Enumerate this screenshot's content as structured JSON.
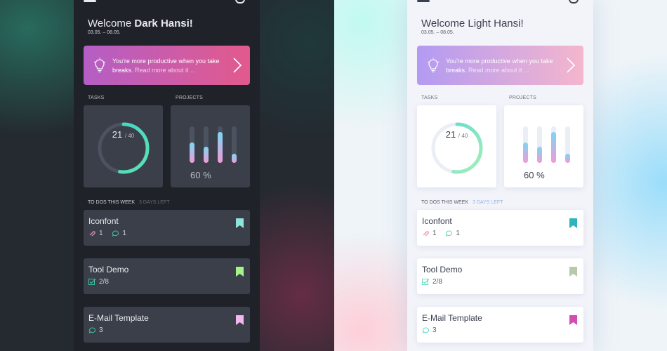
{
  "dark": {
    "welcome_prefix": "Welcome",
    "welcome_name": "Dark Hansi!",
    "dates": "03.05.  –  08.05.",
    "banner": {
      "text": "You're more productive when you take breaks.",
      "more": " Read more about it ..."
    },
    "tasks_label": "TASKS",
    "projects_label": "PROJECTS",
    "tasks_done": "21",
    "tasks_total": "/ 40",
    "tasks_progress": 0.525,
    "projects_percent": "60 %",
    "project_bars": [
      0.55,
      0.45,
      0.85,
      0.25
    ],
    "todo_label": "TO DOS THIS WEEK",
    "todo_sub": "3 DAYS LEFT",
    "todos": [
      {
        "title": "Iconfont",
        "attachments": "1",
        "comments": "1",
        "bookmark_color": "#8fe3dc"
      },
      {
        "title": "Tool Demo",
        "checks": "2/8",
        "bookmark_color": "#a6f28a"
      },
      {
        "title": "E-Mail Template",
        "comments": "3",
        "bookmark_color": "#f0b8ef"
      }
    ]
  },
  "light": {
    "welcome_prefix": "Welcome",
    "welcome_name": "Light Hansi!",
    "dates": "03.05.  –  08.05.",
    "banner": {
      "text": "You're more productive when you take breaks.",
      "more": " Read more about it ..."
    },
    "tasks_label": "TASKS",
    "projects_label": "PROJECTS",
    "tasks_done": "21",
    "tasks_total": "/ 40",
    "tasks_progress": 0.525,
    "projects_percent": "60 %",
    "project_bars": [
      0.55,
      0.45,
      0.85,
      0.25
    ],
    "todo_label": "TO DOS THIS WEEK",
    "todo_sub": "3 DAYS LEFT",
    "todos": [
      {
        "title": "Iconfont",
        "attachments": "1",
        "comments": "1",
        "bookmark_color": "#2fb3bd"
      },
      {
        "title": "Tool Demo",
        "checks": "2/8",
        "bookmark_color": "#b6c9a9"
      },
      {
        "title": "E-Mail Template",
        "comments": "3",
        "bookmark_color": "#cf4fb5"
      }
    ]
  },
  "colors": {
    "accent_green": "#58e3b0",
    "accent_mint": "#44d7b5",
    "paperclip": "#e58fb3"
  }
}
